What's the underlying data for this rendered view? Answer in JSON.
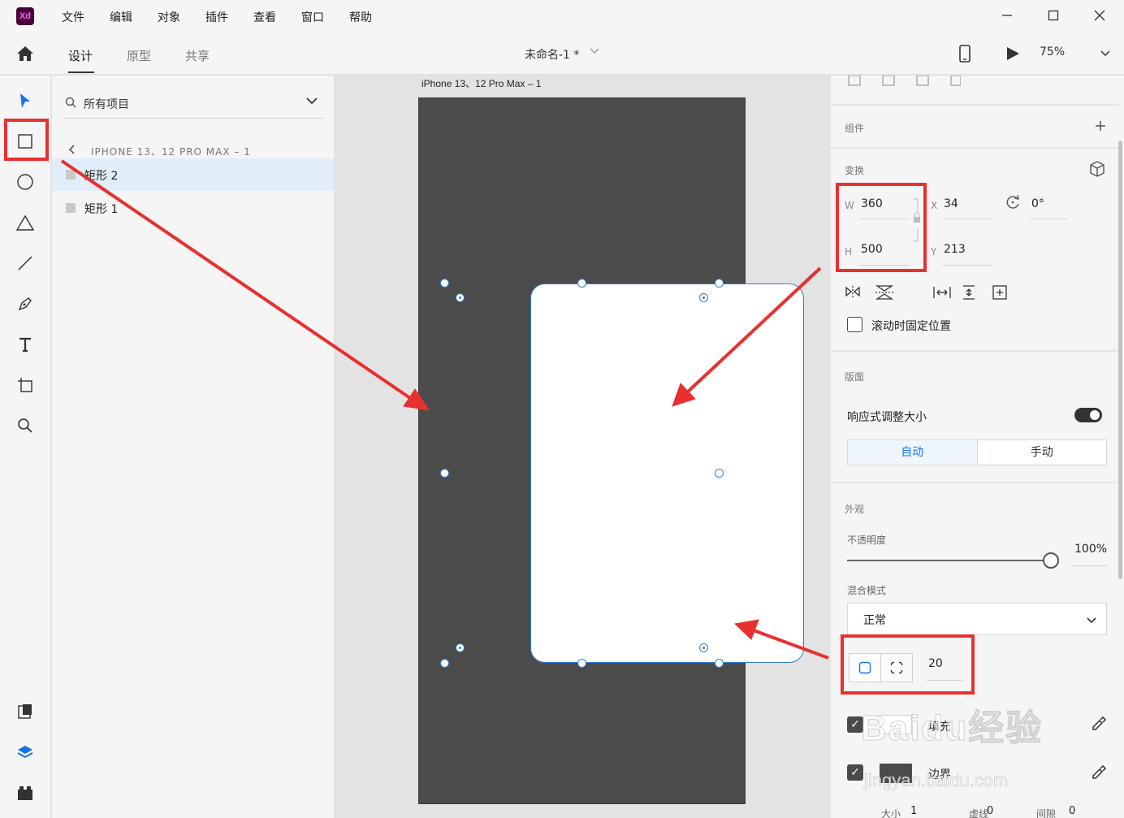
{
  "app": {
    "logo": "Xd"
  },
  "menu": [
    "文件",
    "编辑",
    "对象",
    "插件",
    "查看",
    "窗口",
    "帮助"
  ],
  "window_controls": [
    "minimize-icon",
    "maximize-icon",
    "close-icon"
  ],
  "header": {
    "tabs": [
      "设计",
      "原型",
      "共享"
    ],
    "active_tab": "设计",
    "document_title": "未命名-1 *",
    "zoom": "75%"
  },
  "layers": {
    "search_label": "所有项目",
    "artboard_path": "IPHONE 13、12 PRO MAX – 1",
    "items": [
      {
        "name": "矩形 2",
        "selected": true
      },
      {
        "name": "矩形 1",
        "selected": false
      }
    ]
  },
  "canvas": {
    "artboard_label": "iPhone 13、12 Pro Max – 1",
    "artboard_color": "#4b4b4b",
    "rect_fill": "#ffffff",
    "selection_color": "#2f7fd8"
  },
  "properties": {
    "components_title": "组件",
    "transform_title": "变换",
    "w_label": "W",
    "w_value": "360",
    "h_label": "H",
    "h_value": "500",
    "x_label": "X",
    "x_value": "34",
    "y_label": "Y",
    "y_value": "213",
    "rotation_value": "0°",
    "fix_position_label": "滚动时固定位置",
    "layout_title": "版面",
    "responsive_label": "响应式调整大小",
    "responsive_on": true,
    "auto_label": "自动",
    "manual_label": "手动",
    "appearance_title": "外观",
    "opacity_label": "不透明度",
    "opacity_value": "100%",
    "blend_label": "混合模式",
    "blend_value": "正常",
    "corner_radius": "20",
    "fill_label": "填充",
    "border_label": "边界",
    "size_label": "大小",
    "size_value": "1",
    "dash_label": "虚线",
    "dash_value": "0",
    "gap_label": "间隙",
    "gap_value": "0"
  },
  "watermark": {
    "brand": "Baidu经验",
    "url": "jingyan.baidu.com"
  },
  "colors": {
    "accent": "#1473e6",
    "highlight_red": "#e8302f",
    "layer_selected_bg": "#e1edf8"
  }
}
